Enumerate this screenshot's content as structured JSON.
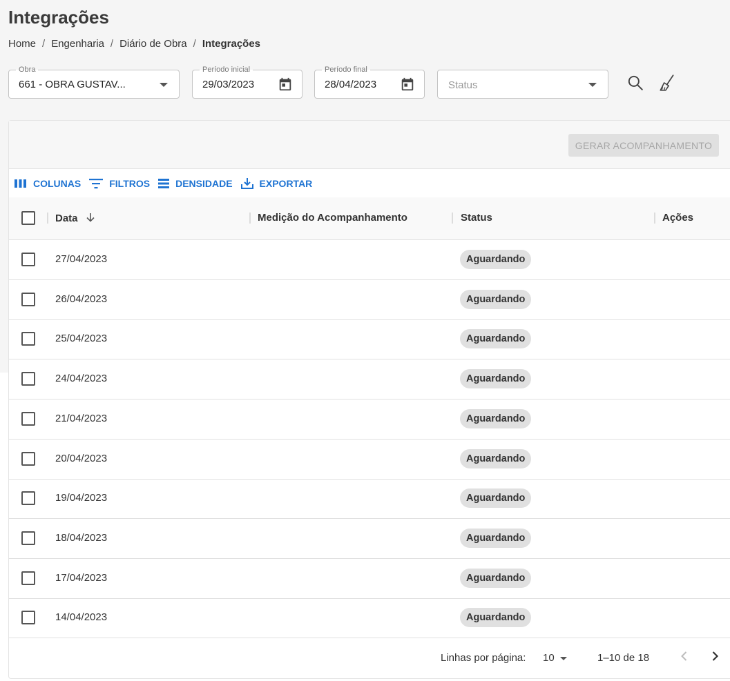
{
  "page": {
    "title": "Integrações"
  },
  "breadcrumb": {
    "items": [
      "Home",
      "Engenharia",
      "Diário de Obra"
    ],
    "current": "Integrações",
    "separator": "/"
  },
  "filters": {
    "obra": {
      "label": "Obra",
      "value": "661 - OBRA GUSTAV..."
    },
    "periodo_inicial": {
      "label": "Período inicial",
      "value": "29/03/2023"
    },
    "periodo_final": {
      "label": "Período final",
      "value": "28/04/2023"
    },
    "status": {
      "placeholder": "Status"
    }
  },
  "actions": {
    "generate_label": "GERAR ACOMPANHAMENTO"
  },
  "toolbar": {
    "columns_label": "COLUNAS",
    "filters_label": "FILTROS",
    "density_label": "DENSIDADE",
    "export_label": "EXPORTAR"
  },
  "table": {
    "columns": {
      "data": "Data",
      "medicao": "Medição do Acompanhamento",
      "status": "Status",
      "acoes": "Ações"
    },
    "rows": [
      {
        "date": "27/04/2023",
        "status": "Aguardando"
      },
      {
        "date": "26/04/2023",
        "status": "Aguardando"
      },
      {
        "date": "25/04/2023",
        "status": "Aguardando"
      },
      {
        "date": "24/04/2023",
        "status": "Aguardando"
      },
      {
        "date": "21/04/2023",
        "status": "Aguardando"
      },
      {
        "date": "20/04/2023",
        "status": "Aguardando"
      },
      {
        "date": "19/04/2023",
        "status": "Aguardando"
      },
      {
        "date": "18/04/2023",
        "status": "Aguardando"
      },
      {
        "date": "17/04/2023",
        "status": "Aguardando"
      },
      {
        "date": "14/04/2023",
        "status": "Aguardando"
      }
    ]
  },
  "pagination": {
    "rows_per_page_label": "Linhas por página:",
    "rows_per_page": "10",
    "range": "1–10 de 18"
  },
  "icons": {
    "search": "search-icon",
    "clear": "broom-icon",
    "calendar": "calendar-icon",
    "columns": "columns-icon",
    "filter": "filter-icon",
    "density": "density-icon",
    "export": "download-icon",
    "sort": "arrow-down-icon"
  },
  "colors": {
    "accent": "#1e73d2",
    "chip": "#e0e0e0",
    "disabled_button": "#e0e0e0"
  }
}
